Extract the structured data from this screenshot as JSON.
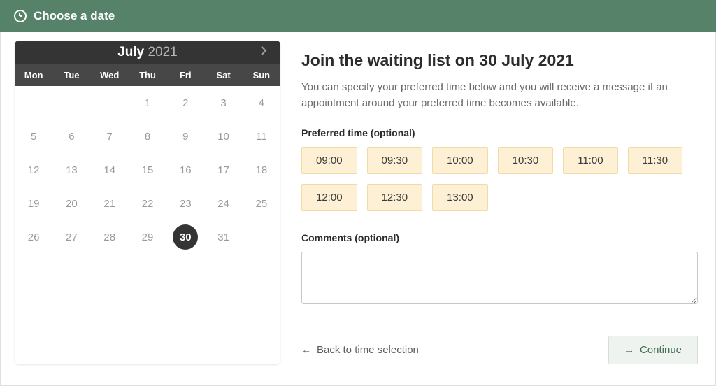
{
  "header": {
    "title": "Choose a date"
  },
  "calendar": {
    "month": "July",
    "year": "2021",
    "weekdays": [
      "Mon",
      "Tue",
      "Wed",
      "Thu",
      "Fri",
      "Sat",
      "Sun"
    ],
    "leading_blanks": 3,
    "days": 31,
    "selected_day": 30
  },
  "waiting_list": {
    "title": "Join the waiting list on 30 July 2021",
    "description": "You can specify your preferred time below and you will receive a message if an appointment around your preferred time becomes available.",
    "preferred_time_label": "Preferred time (optional)",
    "times": [
      "09:00",
      "09:30",
      "10:00",
      "10:30",
      "11:00",
      "11:30",
      "12:00",
      "12:30",
      "13:00"
    ],
    "comments_label": "Comments (optional)"
  },
  "actions": {
    "back_label": "Back to time selection",
    "continue_label": "Continue"
  }
}
